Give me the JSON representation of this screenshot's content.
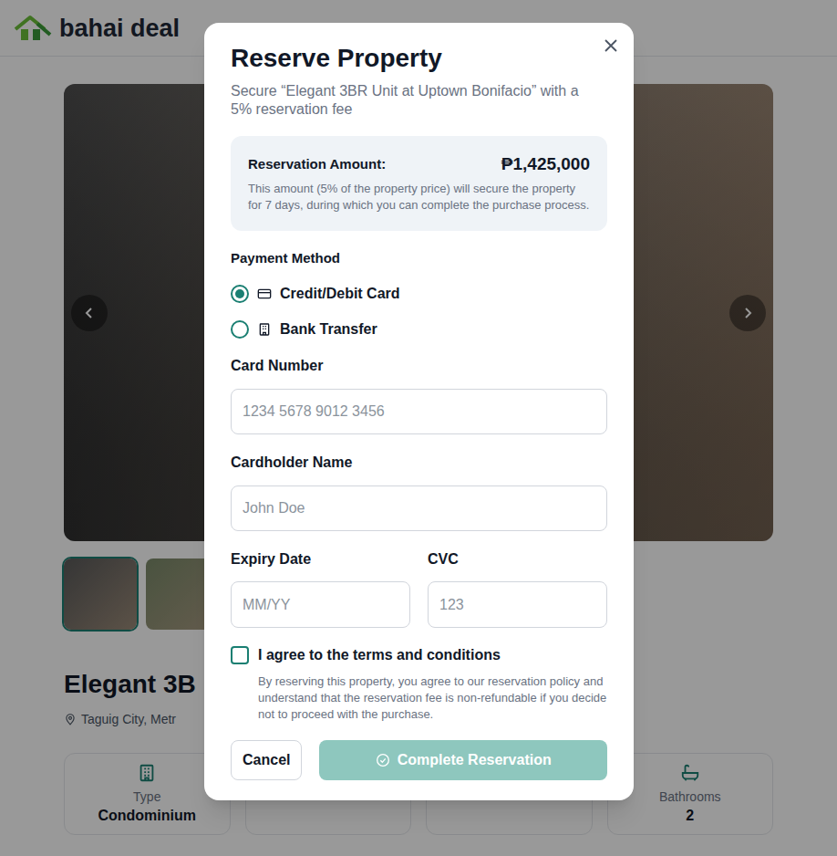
{
  "header": {
    "logo": "bahai deal"
  },
  "gallery": {
    "thumbnails": [
      {
        "selected": true
      },
      {
        "selected": false
      }
    ]
  },
  "property": {
    "title": "Elegant 3B",
    "location": "Taguig City, Metr"
  },
  "stats": [
    {
      "label": "Type",
      "value": "Condominium"
    },
    {
      "label": "Bathrooms",
      "value": "2"
    }
  ],
  "modal": {
    "title": "Reserve Property",
    "subtitle": "Secure “Elegant 3BR Unit at Uptown Bonifacio” with a 5% reservation fee",
    "amount_label": "Reservation Amount:",
    "amount": "₱1,425,000",
    "amount_note": "This amount (5% of the property price) will secure the property for 7 days, during which you can complete the purchase process.",
    "payment_label": "Payment Method",
    "payment_methods": [
      {
        "label": "Credit/Debit Card",
        "selected": true
      },
      {
        "label": "Bank Transfer",
        "selected": false
      }
    ],
    "fields": [
      {
        "label": "Card Number",
        "placeholder": "1234 5678 9012 3456"
      },
      {
        "label": "Cardholder Name",
        "placeholder": "John Doe"
      }
    ],
    "fields_row": [
      {
        "label": "Expiry Date",
        "placeholder": "MM/YY"
      },
      {
        "label": "CVC",
        "placeholder": "123"
      }
    ],
    "terms": {
      "label": "I agree to the terms and conditions",
      "checked": false,
      "note": "By reserving this property, you agree to our reservation policy and understand that the reservation fee is non-refundable if you decide not to proceed with the purchase."
    },
    "buttons": {
      "cancel": "Cancel",
      "submit": {
        "label": "Complete Reservation",
        "disabled": true
      }
    }
  }
}
